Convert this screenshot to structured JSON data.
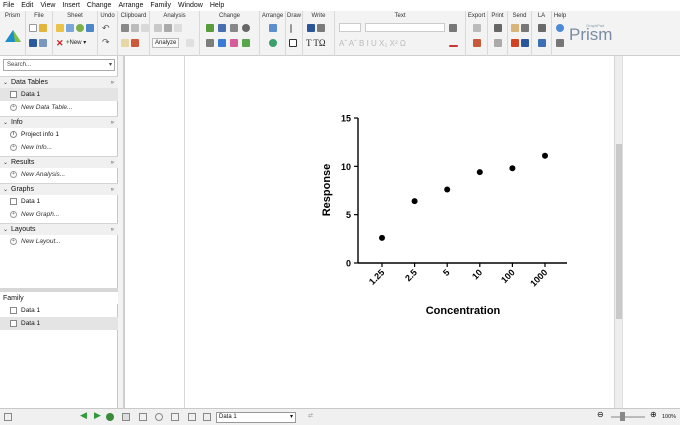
{
  "menu": [
    "File",
    "Edit",
    "View",
    "Insert",
    "Change",
    "Arrange",
    "Family",
    "Window",
    "Help"
  ],
  "ribbon": {
    "groups": [
      "Prism",
      "File",
      "Sheet",
      "Undo",
      "Clipboard",
      "Analysis",
      "Change",
      "Arrange",
      "Draw",
      "Write",
      "Text",
      "Export",
      "Print",
      "Send",
      "LA",
      "Help"
    ],
    "new_label": "New",
    "analyze_label": "Analyze",
    "write_letters": "T TΩ",
    "text_letters": "Aˇ Aˇ B I U X₂ X² Ω",
    "logo": "Prism",
    "logo_small": "GraphPad"
  },
  "sidebar": {
    "search_placeholder": "Search...",
    "sections": [
      {
        "title": "Data Tables",
        "items": [
          {
            "label": "Data 1",
            "kind": "table"
          },
          {
            "label": "New Data Table...",
            "kind": "new"
          }
        ]
      },
      {
        "title": "Info",
        "items": [
          {
            "label": "Project info 1",
            "kind": "info"
          },
          {
            "label": "New Info...",
            "kind": "new"
          }
        ]
      },
      {
        "title": "Results",
        "items": [
          {
            "label": "New Analysis...",
            "kind": "new"
          }
        ]
      },
      {
        "title": "Graphs",
        "items": [
          {
            "label": "Data 1",
            "kind": "graph"
          },
          {
            "label": "New Graph...",
            "kind": "new"
          }
        ]
      },
      {
        "title": "Layouts",
        "items": [
          {
            "label": "New Layout...",
            "kind": "new"
          }
        ]
      }
    ],
    "family": {
      "title": "Family",
      "items": [
        "Data 1",
        "Data 1"
      ]
    }
  },
  "chart_data": {
    "type": "scatter",
    "categories": [
      "1.25",
      "2.5",
      "5",
      "10",
      "100",
      "1000"
    ],
    "values": [
      2.6,
      6.4,
      7.6,
      9.4,
      9.8,
      11.1
    ],
    "xlabel": "Concentration",
    "ylabel": "Response",
    "ylim": [
      0,
      15
    ],
    "yticks": [
      "0",
      "5",
      "10",
      "15"
    ],
    "grid": false
  },
  "statusbar": {
    "sheet_select": "Data 1",
    "zoom": "100%"
  }
}
